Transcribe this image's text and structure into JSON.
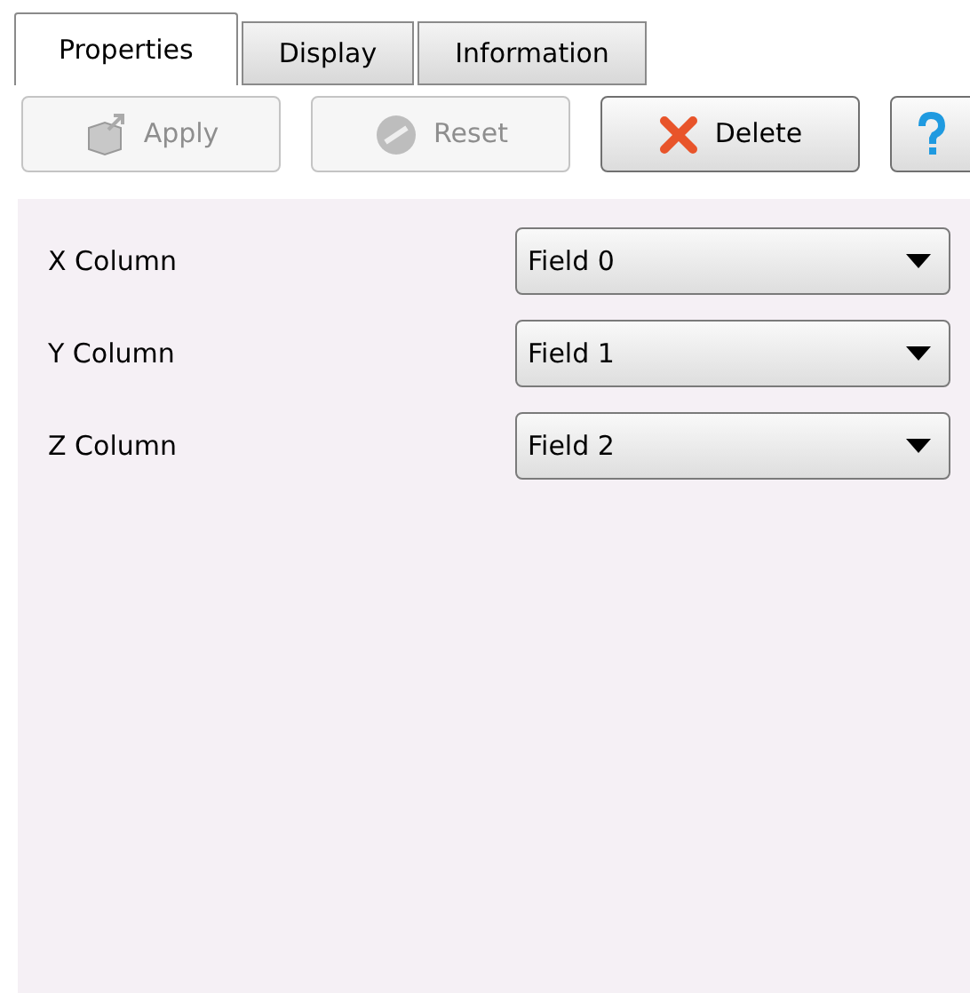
{
  "tabs": [
    {
      "label": "Properties",
      "selected": true
    },
    {
      "label": "Display",
      "selected": false
    },
    {
      "label": "Information",
      "selected": false
    }
  ],
  "toolbar": [
    {
      "kind": "apply",
      "label": "Apply",
      "disabled": true
    },
    {
      "kind": "reset",
      "label": "Reset",
      "disabled": true
    },
    {
      "kind": "delete",
      "label": "Delete",
      "disabled": false
    },
    {
      "kind": "help",
      "disabled": false
    }
  ],
  "fields": [
    {
      "label": "X Column",
      "value": "Field 0"
    },
    {
      "label": "Y Column",
      "value": "Field 1"
    },
    {
      "label": "Z Column",
      "value": "Field 2"
    }
  ]
}
